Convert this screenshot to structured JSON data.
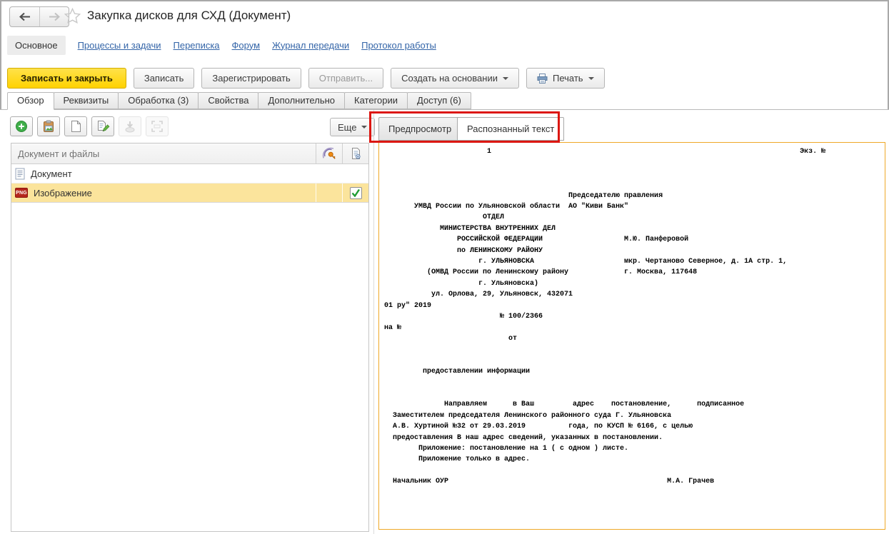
{
  "window": {
    "title": "Закупка дисков для СХД (Документ)"
  },
  "nav": {
    "active": "Основное",
    "links": [
      "Процессы и задачи",
      "Переписка",
      "Форум",
      "Журнал передачи",
      "Протокол работы"
    ]
  },
  "commands": {
    "save_close": "Записать и закрыть",
    "save": "Записать",
    "register": "Зарегистрировать",
    "send": "Отправить...",
    "create_based": "Создать на основании",
    "print": "Печать"
  },
  "tabs": {
    "active": "Обзор",
    "items": [
      "Обзор",
      "Реквизиты",
      "Обработка (3)",
      "Свойства",
      "Дополнительно",
      "Категории",
      "Доступ (6)"
    ]
  },
  "files": {
    "more": "Еще",
    "header": "Документ и файлы",
    "rows": [
      {
        "label": "Документ",
        "icon": "document",
        "checked": false
      },
      {
        "label": "Изображение",
        "icon": "png-file",
        "badge": "PNG",
        "checked": true,
        "selected": true
      }
    ]
  },
  "preview": {
    "tab_preview": "Предпросмотр",
    "tab_recognized": "Распознанный текст",
    "page_lines": [
      "                        1                                                                        Экз. №",
      "",
      "",
      "",
      "                                           Председателю правления",
      "       УМВД России по Ульяновской области  АО \"Киви Банк\"",
      "                       ОТДЕЛ",
      "             МИНИСТЕРСТВА ВНУТРЕННИХ ДЕЛ",
      "                 РОССИЙСКОЙ ФЕДЕРАЦИИ                   М.Ю. Панферовой",
      "                 по ЛЕНИНСКОМУ РАЙОНУ",
      "                      г. УЛЬЯНОВСКА                     мкр. Чертаново Северное, д. 1А стр. 1,",
      "          (ОМВД России по Ленинскому району             г. Москва, 117648",
      "                      г. Ульяновска)",
      "           ул. Орлова, 29, Ульяновск, 432071",
      "01 ру\" 2019",
      "                           № 100/2366",
      "на №",
      "                             от",
      "",
      "",
      "         предоставлении информации",
      "",
      "",
      "              Направляем      в Ваш         адрес    постановление,      подписанное",
      "  Заместителем председателя Ленинского районного суда Г. Ульяновска",
      "  А.В. Хуртиной №32 от 29.03.2019          года, по КУСП № 6166, с целью",
      "  предоставления В наш адрес сведений, указанных в постановлении.",
      "        Приложение: постановление на 1 ( с одном ) листе.",
      "        Приложение только в адрес.",
      "",
      "  Начальник ОУР                                                   М.А. Грачев"
    ]
  },
  "icons": {
    "back": "arrow-left",
    "forward": "arrow-right",
    "favorite": "star-outline",
    "print": "printer",
    "dropdown": "triangle-down",
    "add": "plus-circle",
    "paste_image": "clipboard-image",
    "new_file": "blank-page",
    "edit_file": "page-pencil",
    "import": "arrow-into-tray",
    "scan": "scanner-frame",
    "web_key": "key-waves",
    "file_props": "page-gear",
    "document": "page-lines",
    "image_file": "png-badge",
    "check": "green-check"
  },
  "colors": {
    "accent_yellow": "#ffd200",
    "selection_yellow": "#fbe49c",
    "annotation_red": "#dc1712",
    "preview_border": "#efa928",
    "link_blue": "#3465a8",
    "check_green": "#1f9c34"
  }
}
